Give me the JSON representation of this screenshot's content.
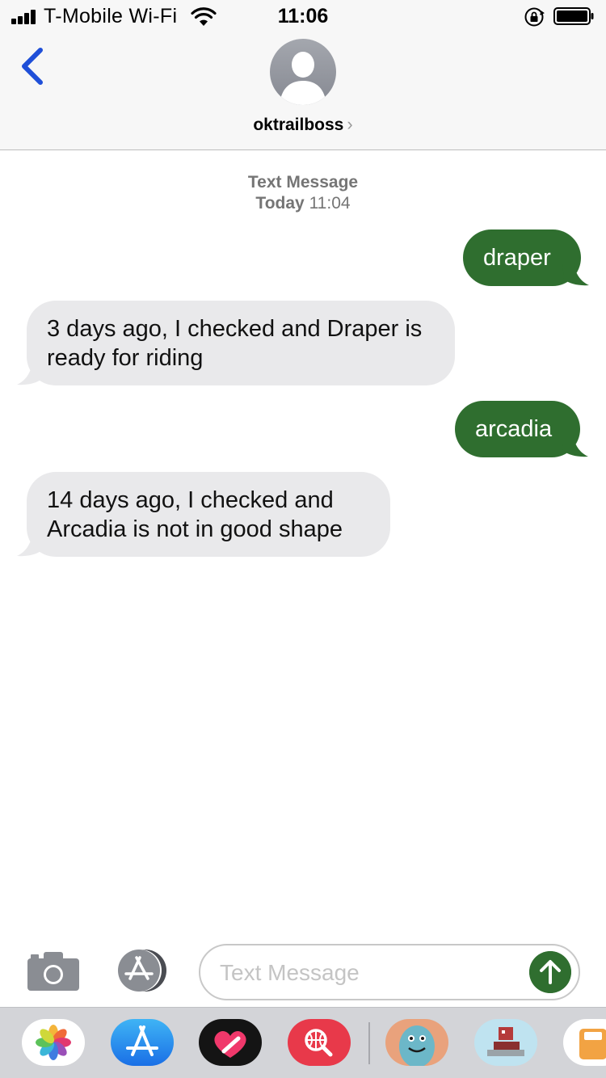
{
  "status_bar": {
    "carrier": "T-Mobile Wi-Fi",
    "time": "11:06",
    "signal_bars": 4,
    "battery_level_percent": 100,
    "icons": [
      "signal-icon",
      "wifi-icon",
      "rotation-lock-icon",
      "battery-icon"
    ]
  },
  "header": {
    "contact_name": "oktrailboss",
    "contact_chevron": "›",
    "icons": [
      "back-chevron-icon",
      "contact-avatar-icon"
    ]
  },
  "thread": {
    "service_label": "Text Message",
    "date_day": "Today",
    "date_time": "11:04",
    "messages": [
      {
        "direction": "outgoing",
        "text": "draper"
      },
      {
        "direction": "incoming",
        "text": "3 days ago, I checked and Draper is ready for riding"
      },
      {
        "direction": "outgoing",
        "text": "arcadia"
      },
      {
        "direction": "incoming",
        "text": "14 days ago, I checked and Arcadia is not in good shape"
      }
    ]
  },
  "input_bar": {
    "placeholder": "Text Message",
    "icons": [
      "camera-icon",
      "app-store-icon",
      "send-arrow-icon"
    ]
  },
  "app_drawer": {
    "apps": [
      "photos-icon",
      "app-store-icon",
      "digital-touch-icon",
      "web-search-icon",
      "sticker-monster-icon",
      "sticker-game-icon",
      "more-app-icon"
    ]
  },
  "colors": {
    "outgoing_bubble": "#2f6e2f",
    "incoming_bubble": "#e9e9eb",
    "back_accent": "#1f4fd8",
    "meta_text": "#757575"
  }
}
